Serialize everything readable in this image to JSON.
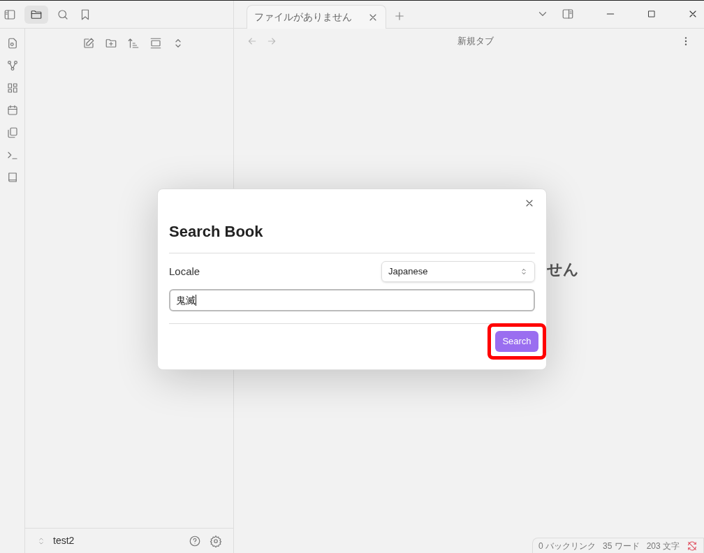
{
  "tab": {
    "title": "ファイルがありません",
    "selected": true
  },
  "nav_title": "新規タブ",
  "background_text": "せん",
  "vault": {
    "name": "test2"
  },
  "status_bar": [
    "0 バックリンク",
    "35 ワード",
    "203 文字"
  ],
  "dialog": {
    "title": "Search Book",
    "locale_label": "Locale",
    "locale_value": "Japanese",
    "query": "鬼滅",
    "button": "Search",
    "button_highlighted": true
  }
}
